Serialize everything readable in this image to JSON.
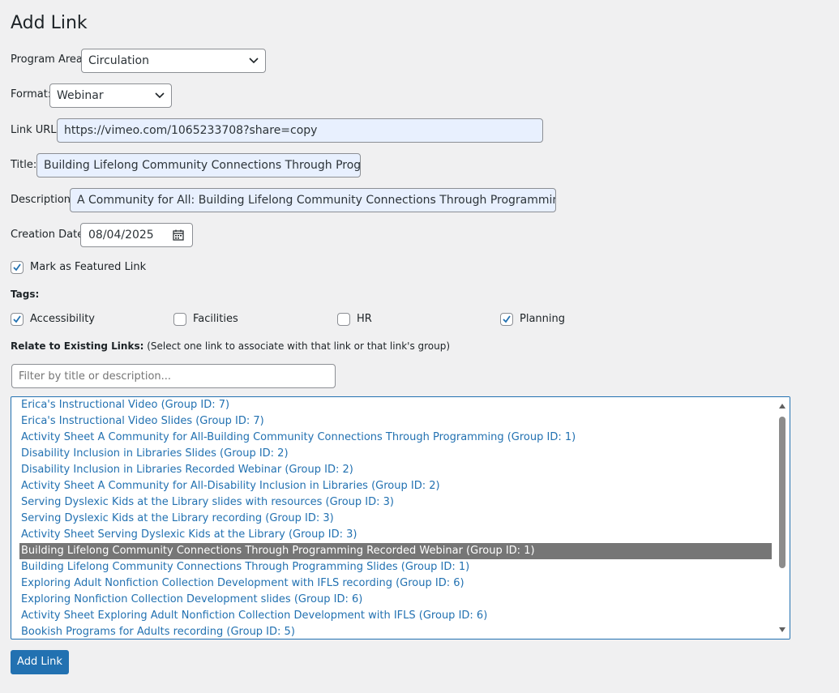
{
  "page_title": "Add Link",
  "form": {
    "program_area": {
      "label": "Program Area:",
      "value": "Circulation"
    },
    "format": {
      "label": "Format:",
      "value": "Webinar"
    },
    "link_url": {
      "label": "Link URL:",
      "value": "https://vimeo.com/1065233708?share=copy"
    },
    "title": {
      "label": "Title:",
      "value": "Building Lifelong Community Connections Through Programm"
    },
    "description": {
      "label": "Description:",
      "value": "A Community for All:  Building Lifelong Community Connections Through Programming with S"
    },
    "creation_date": {
      "label": "Creation Date:",
      "value": "08/04/2025"
    },
    "featured": {
      "label": "Mark as Featured Link",
      "checked": true
    },
    "tags_label": "Tags:",
    "tags": [
      {
        "label": "Accessibility",
        "checked": true
      },
      {
        "label": "Facilities",
        "checked": false
      },
      {
        "label": "HR",
        "checked": false
      },
      {
        "label": "Planning",
        "checked": true
      }
    ],
    "relate": {
      "label_bold": "Relate to Existing Links:",
      "label_hint": "(Select one link to associate with that link or that link's group)",
      "filter_placeholder": "Filter by title or description...",
      "options": [
        "Erica's Instructional Video (Group ID: 7)",
        "Erica's Instructional Video Slides (Group ID: 7)",
        "Activity Sheet A Community for All-Building Community Connections Through Programming (Group ID: 1)",
        "Disability Inclusion in Libraries Slides (Group ID: 2)",
        "Disability Inclusion in Libraries Recorded Webinar (Group ID: 2)",
        "Activity Sheet A Community for All-Disability Inclusion in Libraries (Group ID: 2)",
        "Serving Dyslexic Kids at the Library slides with resources (Group ID: 3)",
        "Serving Dyslexic Kids at the Library recording (Group ID: 3)",
        "Activity Sheet Serving Dyslexic Kids at the Library (Group ID: 3)",
        "Building Lifelong Community Connections Through Programming Recorded Webinar (Group ID: 1)",
        "Building Lifelong Community Connections Through Programming Slides (Group ID: 1)",
        "Exploring Adult Nonfiction Collection Development with IFLS recording (Group ID: 6)",
        "Exploring Nonfiction Collection Development slides (Group ID: 6)",
        "Activity Sheet Exploring Adult Nonfiction Collection Development with IFLS (Group ID: 6)",
        "Bookish Programs for Adults recording (Group ID: 5)"
      ],
      "selected_index": 9
    },
    "submit_label": "Add Link"
  },
  "colors": {
    "accent": "#2271b1",
    "selected_bg": "#767676",
    "autofill_bg": "#e8f0fe",
    "page_bg": "#f0f0f1"
  },
  "icons": {
    "select_arrow": "chevron-down-icon",
    "calendar": "calendar-icon",
    "checkbox": "checkmark-icon",
    "scroll_up": "triangle-up-icon",
    "scroll_down": "triangle-down-icon"
  }
}
